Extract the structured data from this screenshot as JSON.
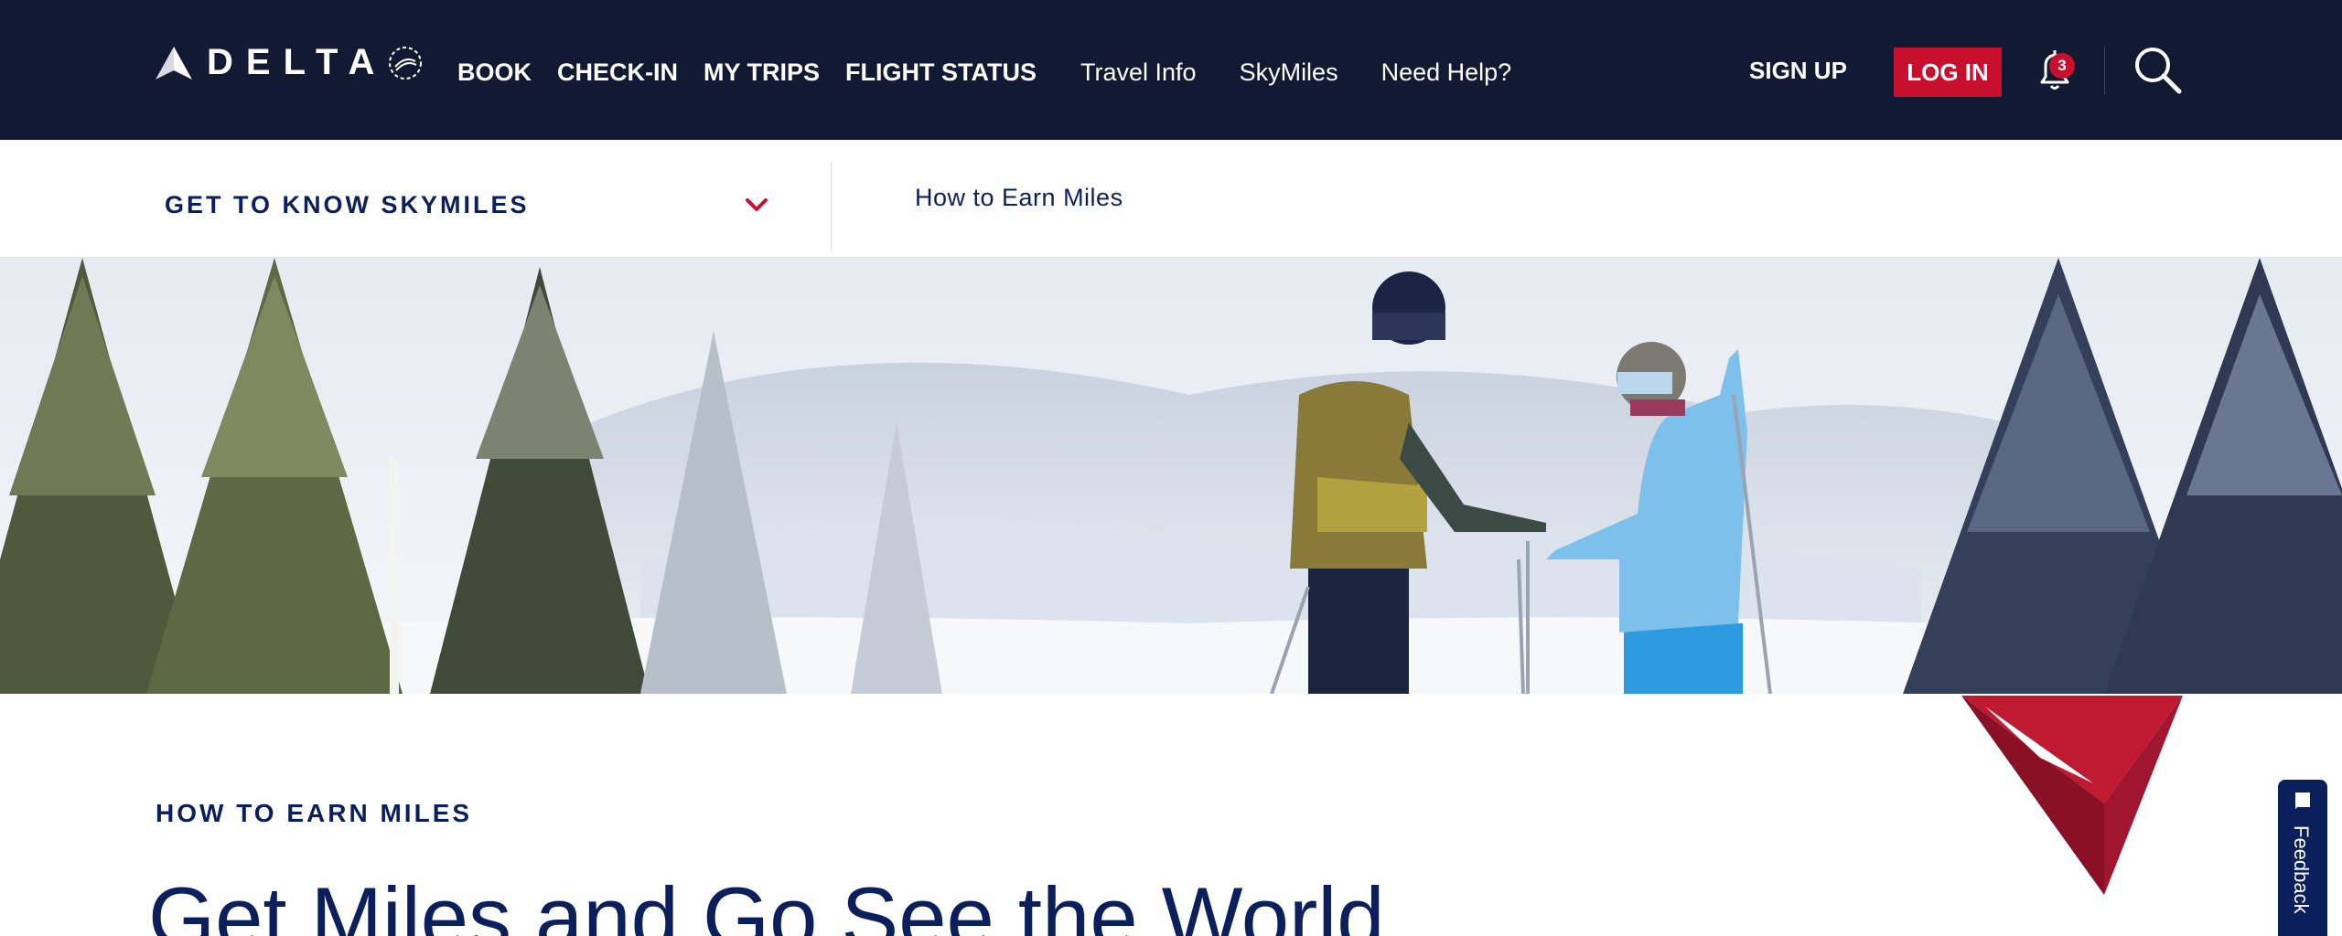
{
  "topnav": {
    "logo_text": "DELTA",
    "primary": [
      "BOOK",
      "CHECK-IN",
      "MY TRIPS",
      "FLIGHT STATUS"
    ],
    "secondary": [
      "Travel Info",
      "SkyMiles",
      "Need Help?"
    ],
    "signup_label": "SIGN UP",
    "login_label": "LOG IN",
    "notification_count": "3",
    "icons": {
      "bell": "bell-icon",
      "search": "search-icon",
      "skyteam": "skyteam-icon"
    }
  },
  "subnav": {
    "title": "GET TO KNOW SKYMILES",
    "link": "How to Earn Miles"
  },
  "content": {
    "eyebrow": "HOW TO EARN MILES",
    "headline": "Get Miles and Go See the World"
  },
  "feedback": {
    "label": "Feedback"
  },
  "colors": {
    "navy": "#111a32",
    "brand_navy": "#0b1f5c",
    "brand_red": "#c8102e"
  }
}
